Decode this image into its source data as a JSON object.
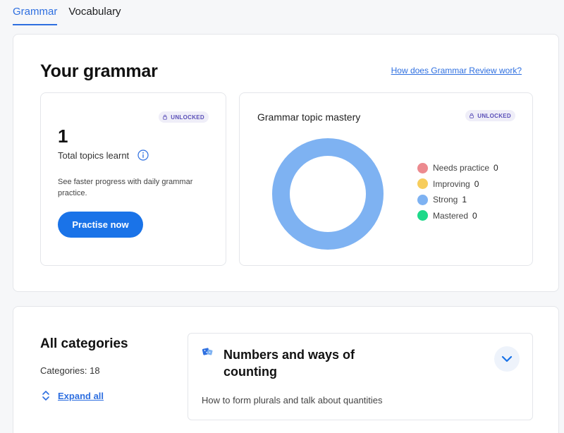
{
  "tabs": [
    {
      "label": "Grammar",
      "active": true
    },
    {
      "label": "Vocabulary",
      "active": false
    }
  ],
  "overview": {
    "title": "Your grammar",
    "help_link": "How does Grammar Review work?",
    "badge_label": "UNLOCKED",
    "total": {
      "count": "1",
      "label": "Total topics learnt",
      "description": "See faster progress with daily grammar practice.",
      "cta": "Practise now"
    },
    "mastery": {
      "title": "Grammar topic mastery",
      "legend": [
        {
          "label": "Needs practice",
          "value": "0",
          "color": "#ec8a8f"
        },
        {
          "label": "Improving",
          "value": "0",
          "color": "#f7cd5c"
        },
        {
          "label": "Strong",
          "value": "1",
          "color": "#7eb2f2"
        },
        {
          "label": "Mastered",
          "value": "0",
          "color": "#1ed98a"
        }
      ]
    }
  },
  "categories": {
    "title": "All categories",
    "count_text": "Categories: 18",
    "expand_label": "Expand all",
    "topics": [
      {
        "title": "Numbers and ways of counting",
        "description": "How to form plurals and talk about quantities",
        "icon": "dice-icon"
      }
    ]
  },
  "colors": {
    "accent": "#2e6fe0",
    "button": "#1a73e8",
    "badge_bg": "#efeef8",
    "badge_text": "#5a4fb8"
  }
}
